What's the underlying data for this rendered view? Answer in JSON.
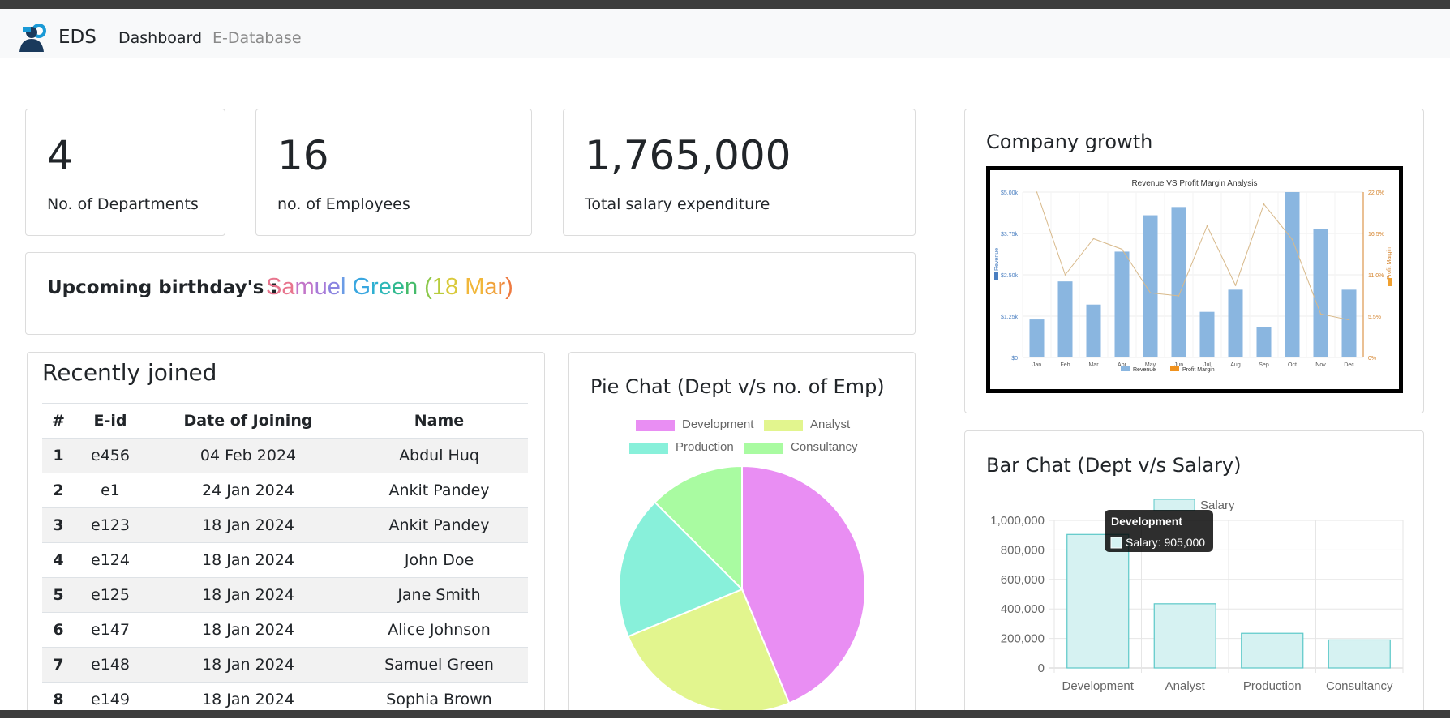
{
  "app": {
    "brand": "EDS",
    "nav": {
      "dashboard": "Dashboard",
      "edatabase": "E-Database"
    }
  },
  "stats": [
    {
      "value": "4",
      "label": "No. of Departments"
    },
    {
      "value": "16",
      "label": "no. of Employees"
    },
    {
      "value": "1,765,000",
      "label": "Total salary expenditure"
    }
  ],
  "birthday": {
    "label": "Upcoming birthday's :",
    "name_parts": [
      "S",
      "a",
      "m",
      "u",
      "e",
      "l",
      " ",
      "G",
      "r",
      "e",
      "e",
      "n",
      " ",
      "(",
      "1",
      "8",
      " ",
      "M",
      "a",
      "r",
      ")"
    ],
    "colors": [
      "#e8758e",
      "#e8758e",
      "#c275c9",
      "#a77ad8",
      "#8a84e0",
      "#6b9ce6",
      "#ffffff",
      "#3aa7e0",
      "#2fb0d2",
      "#2db7b7",
      "#30b98f",
      "#45bb6a",
      "#ffffff",
      "#8cc84b",
      "#b8cc3d",
      "#d9c93a",
      "#ffffff",
      "#f1b73a",
      "#f0a33c",
      "#ef8c3e",
      "#ee7a40"
    ]
  },
  "recent": {
    "title": "Recently joined",
    "columns": [
      "#",
      "E-id",
      "Date of Joining",
      "Name"
    ],
    "rows": [
      [
        "1",
        "e456",
        "04 Feb 2024",
        "Abdul Huq"
      ],
      [
        "2",
        "e1",
        "24 Jan 2024",
        "Ankit Pandey"
      ],
      [
        "3",
        "e123",
        "18 Jan 2024",
        "Ankit Pandey"
      ],
      [
        "4",
        "e124",
        "18 Jan 2024",
        "John Doe"
      ],
      [
        "5",
        "e125",
        "18 Jan 2024",
        "Jane Smith"
      ],
      [
        "6",
        "e147",
        "18 Jan 2024",
        "Alice Johnson"
      ],
      [
        "7",
        "e148",
        "18 Jan 2024",
        "Samuel Green"
      ],
      [
        "8",
        "e149",
        "18 Jan 2024",
        "Sophia Brown"
      ]
    ]
  },
  "pie": {
    "title": "Pie Chat (Dept v/s no. of Emp)",
    "legend": [
      "Development",
      "Analyst",
      "Production",
      "Consultancy"
    ],
    "colors": [
      "#e98ef3",
      "#e2f58e",
      "#88f0da",
      "#a9fba1"
    ]
  },
  "growth": {
    "title": "Company growth",
    "months": [
      "Jan",
      "Feb",
      "Mar",
      "Apr",
      "May",
      "Jun",
      "Jul",
      "Aug",
      "Sep",
      "Oct",
      "Nov",
      "Dec"
    ],
    "left_ticks": [
      "$0",
      "$1.25k",
      "$2.50k",
      "$3.75k",
      "$5.00k"
    ],
    "right_ticks": [
      "0%",
      "5.5%",
      "11.0%",
      "16.5%",
      "22.0%"
    ],
    "left_axis_label": "Revenue",
    "right_axis_label": "Profit Margin",
    "legend": [
      "Revenue",
      "Profit Margin"
    ],
    "chart_title": "Revenue VS Profit Margin Analysis"
  },
  "bar": {
    "title": "Bar Chat (Dept v/s Salary)",
    "legend": "Salary",
    "tooltip_title": "Development",
    "tooltip_body": "Salary: 905,000",
    "y_ticks": [
      "0",
      "200,000",
      "400,000",
      "600,000",
      "800,000",
      "1,000,000"
    ]
  },
  "chart_data": [
    {
      "type": "pie",
      "title": "Pie Chat (Dept v/s no. of Emp)",
      "categories": [
        "Development",
        "Analyst",
        "Production",
        "Consultancy"
      ],
      "values": [
        7,
        4,
        3,
        2
      ],
      "colors": [
        "#e98ef3",
        "#e2f58e",
        "#88f0da",
        "#a9fba1"
      ],
      "legend": "top"
    },
    {
      "type": "bar",
      "title": "Revenue VS Profit Margin Analysis",
      "categories": [
        "Jan",
        "Feb",
        "Mar",
        "Apr",
        "May",
        "Jun",
        "Jul",
        "Aug",
        "Sep",
        "Oct",
        "Nov",
        "Dec"
      ],
      "series": [
        {
          "name": "Revenue",
          "type": "bar",
          "axis": "left",
          "values": [
            1150,
            2300,
            1600,
            3200,
            4300,
            4550,
            1380,
            2050,
            920,
            5000,
            3880,
            2050
          ]
        },
        {
          "name": "Profit Margin",
          "type": "line",
          "axis": "right",
          "values": [
            22.0,
            11.0,
            15.8,
            14.4,
            8.6,
            8.2,
            17.5,
            9.6,
            20.4,
            15.7,
            5.8,
            5.0
          ]
        }
      ],
      "ylim": [
        0,
        5000
      ],
      "y2lim": [
        0,
        22
      ],
      "ylabel": "Revenue",
      "y2label": "Profit Margin",
      "legend": "bottom"
    },
    {
      "type": "bar",
      "title": "",
      "categories": [
        "Development",
        "Analyst",
        "Production",
        "Consultancy"
      ],
      "series": [
        {
          "name": "Salary",
          "values": [
            905000,
            435000,
            235000,
            190000
          ]
        }
      ],
      "ylim": [
        0,
        1000000
      ],
      "legend": "top",
      "grid": true
    }
  ]
}
